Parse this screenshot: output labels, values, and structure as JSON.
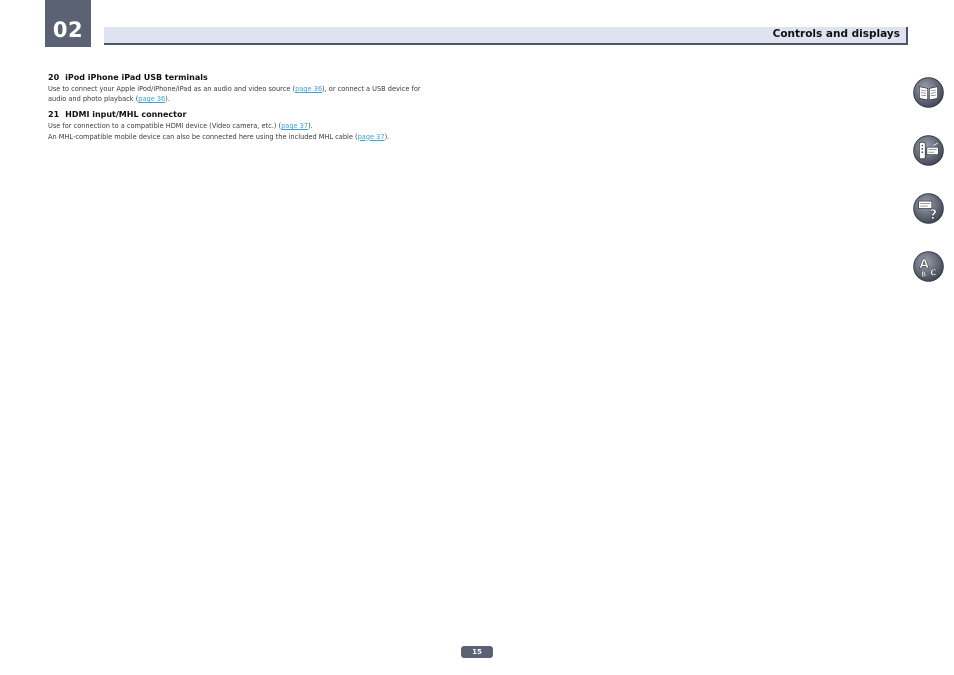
{
  "chapter": {
    "number": "02"
  },
  "header": {
    "title": "Controls and displays"
  },
  "sections": [
    {
      "number": "20",
      "heading": "iPod iPhone iPad USB terminals",
      "lines": [
        {
          "before": "Use to connect your Apple iPod/iPhone/iPad as an audio and video source (",
          "link": "page 36",
          "after": "), or connect a USB device for"
        },
        {
          "before": "audio and photo playback (",
          "link": "page 36",
          "after": ")."
        }
      ]
    },
    {
      "number": "21",
      "heading": "HDMI input/MHL connector",
      "lines": [
        {
          "before": "Use for connection to a compatible HDMI device (Video camera, etc.) (",
          "link": "page 37",
          "after": ")."
        },
        {
          "before": "An MHL-compatible mobile device can also be connected here using the included MHL cable (",
          "link": "page 37",
          "after": ")."
        }
      ]
    }
  ],
  "side_nav": [
    {
      "icon": "open-book-icon"
    },
    {
      "icon": "remote-receiver-icon"
    },
    {
      "icon": "help-question-icon"
    },
    {
      "icon": "index-abc-icon"
    }
  ],
  "footer": {
    "page_number": "15"
  },
  "colors": {
    "accent": "#5b6273",
    "header_bg": "#dfe3ef",
    "link": "#3aa3d8"
  }
}
